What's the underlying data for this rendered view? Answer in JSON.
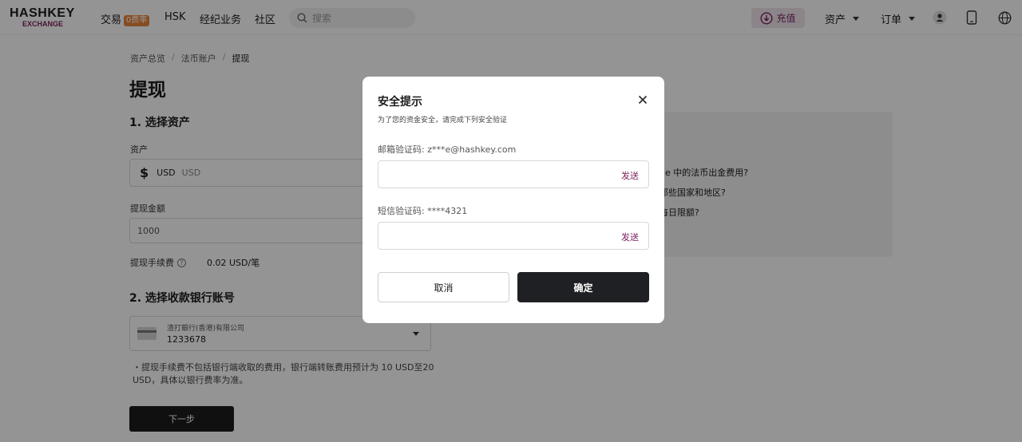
{
  "header": {
    "logo_top": "HASHKEY",
    "logo_bottom": "EXCHANGE",
    "nav": [
      "交易",
      "HSK",
      "经纪业务",
      "社区"
    ],
    "trade_badge": "0费率",
    "search_placeholder": "搜索",
    "deposit_label": "充值",
    "assets_label": "资产",
    "orders_label": "订单",
    "accent_color": "#7b1f5c",
    "icons": [
      "search-icon",
      "deposit-icon",
      "user-icon",
      "phone-icon",
      "globe-icon"
    ]
  },
  "breadcrumb": [
    "资产总览",
    "法币账户",
    "提现"
  ],
  "page": {
    "title": "提现",
    "step1": "1. 选择资产",
    "asset_label": "资产",
    "asset_code": "USD",
    "asset_name": "USD",
    "amount_label": "提现金额",
    "amount_value": "1000",
    "fee_label": "提现手续费",
    "fee_value": "0.02 USD/笔",
    "step2": "2. 选择收款银行账号",
    "bank_name": "渣打銀行(香港)有限公司",
    "bank_account": "1233678",
    "note": "提现手续费不包括银行端收取的费用，银行端转账费用预计为 10 USD至20 USD，具体以银行费率为准。",
    "next_label": "下一步"
  },
  "faq": {
    "q1": "ge 中的法币出金费用?",
    "q2": "那些国家和地区?",
    "q3": "每日限额?"
  },
  "modal": {
    "title": "安全提示",
    "subtitle": "为了您的资金安全，请完成下列安全验证",
    "email_label": "邮箱验证码: z***e@hashkey.com",
    "sms_label": "短信验证码: ****4321",
    "send_label": "发送",
    "cancel_label": "取消",
    "confirm_label": "确定"
  }
}
